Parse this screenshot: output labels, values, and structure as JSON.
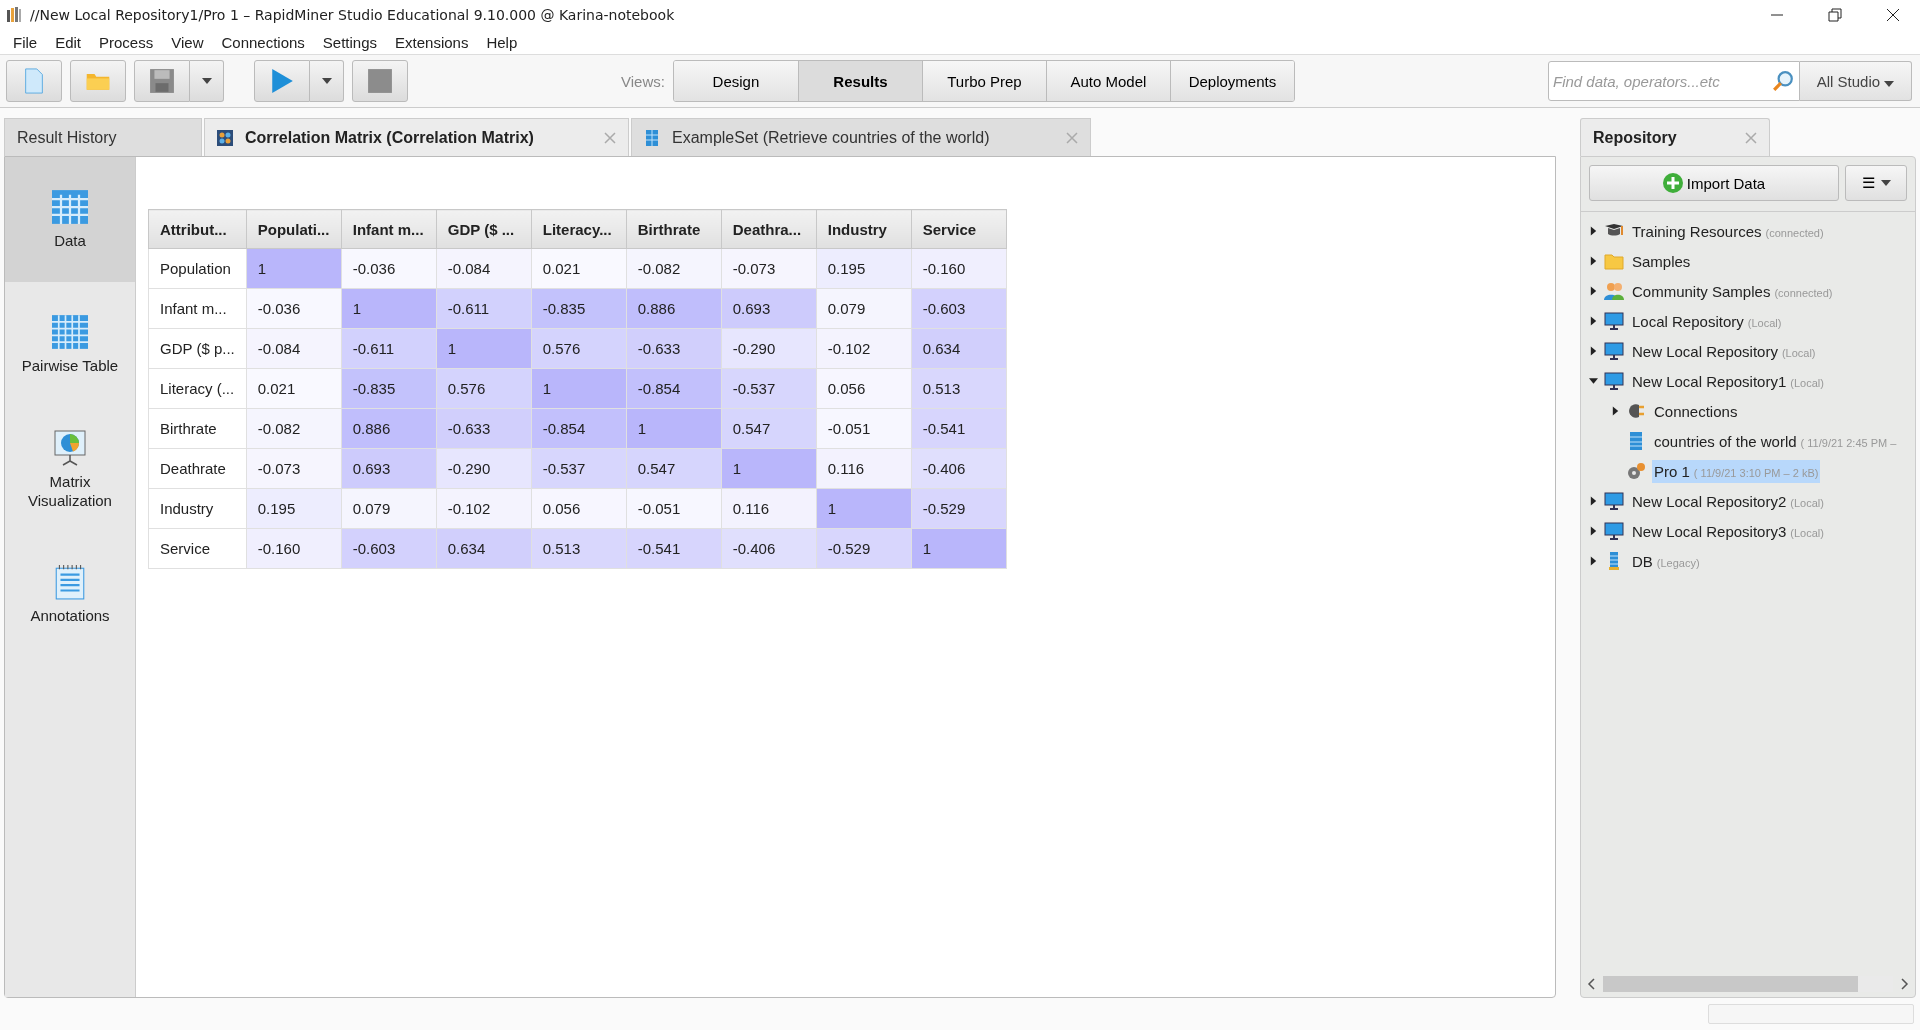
{
  "window": {
    "title": "//New Local Repository1/Pro 1 – RapidMiner Studio Educational 9.10.000 @ Karina-notebook"
  },
  "menu": [
    "File",
    "Edit",
    "Process",
    "View",
    "Connections",
    "Settings",
    "Extensions",
    "Help"
  ],
  "views": {
    "label": "Views:",
    "items": [
      {
        "label": "Design",
        "selected": false
      },
      {
        "label": "Results",
        "selected": true
      },
      {
        "label": "Turbo Prep",
        "selected": false
      },
      {
        "label": "Auto Model",
        "selected": false
      },
      {
        "label": "Deployments",
        "selected": false
      }
    ]
  },
  "search": {
    "placeholder": "Find data, operators...etc",
    "scope": "All Studio"
  },
  "result_tabs": [
    {
      "label": "Result History",
      "kind": "history",
      "selected": false
    },
    {
      "label": "Correlation Matrix (Correlation Matrix)",
      "kind": "matrix",
      "selected": true
    },
    {
      "label": "ExampleSet (Retrieve countries of the world)",
      "kind": "table",
      "selected": false
    }
  ],
  "side_views": [
    {
      "label": "Data",
      "kind": "data",
      "selected": true
    },
    {
      "label": "Pairwise Table",
      "kind": "pairwise",
      "selected": false
    },
    {
      "label": "Matrix Visualization",
      "kind": "viz",
      "selected": false
    },
    {
      "label": "Annotations",
      "kind": "notes",
      "selected": false
    }
  ],
  "table": {
    "columns": [
      "Attribut...",
      "Populati...",
      "Infant m...",
      "GDP ($ ...",
      "Literacy...",
      "Birthrate",
      "Deathra...",
      "Industry",
      "Service"
    ],
    "rows": [
      [
        "Population",
        "1",
        "-0.036",
        "-0.084",
        "0.021",
        "-0.082",
        "-0.073",
        "0.195",
        "-0.160"
      ],
      [
        "Infant m...",
        "-0.036",
        "1",
        "-0.611",
        "-0.835",
        "0.886",
        "0.693",
        "0.079",
        "-0.603"
      ],
      [
        "GDP ($ p...",
        "-0.084",
        "-0.611",
        "1",
        "0.576",
        "-0.633",
        "-0.290",
        "-0.102",
        "0.634"
      ],
      [
        "Literacy (...",
        "0.021",
        "-0.835",
        "0.576",
        "1",
        "-0.854",
        "-0.537",
        "0.056",
        "0.513"
      ],
      [
        "Birthrate",
        "-0.082",
        "0.886",
        "-0.633",
        "-0.854",
        "1",
        "0.547",
        "-0.051",
        "-0.541"
      ],
      [
        "Deathrate",
        "-0.073",
        "0.693",
        "-0.290",
        "-0.537",
        "0.547",
        "1",
        "0.116",
        "-0.406"
      ],
      [
        "Industry",
        "0.195",
        "0.079",
        "-0.102",
        "0.056",
        "-0.051",
        "0.116",
        "1",
        "-0.529"
      ],
      [
        "Service",
        "-0.160",
        "-0.603",
        "0.634",
        "0.513",
        "-0.541",
        "-0.406",
        "-0.529",
        "1"
      ]
    ]
  },
  "repository": {
    "title": "Repository",
    "import_button": "Import Data",
    "menu_button": "☰",
    "tree": [
      {
        "name": "Training Resources",
        "note": "(connected)",
        "kind": "training",
        "expanded": false,
        "selected": false
      },
      {
        "name": "Samples",
        "kind": "folder",
        "expanded": false,
        "selected": false
      },
      {
        "name": "Community Samples",
        "note": "(connected)",
        "kind": "community",
        "expanded": false,
        "selected": false
      },
      {
        "name": "Local Repository",
        "note": "(Local)",
        "kind": "repo",
        "expanded": false,
        "selected": false
      },
      {
        "name": "New Local Repository",
        "note": "(Local)",
        "kind": "repo",
        "expanded": false,
        "selected": false
      },
      {
        "name": "New Local Repository1",
        "note": "(Local)",
        "kind": "repo",
        "expanded": true,
        "selected": false,
        "children": [
          {
            "name": "Connections",
            "kind": "connections",
            "expanded": false,
            "selected": false
          },
          {
            "name": "countries of the world",
            "note": "( 11/9/21 2:45 PM –",
            "kind": "data",
            "selected": false
          },
          {
            "name": "Pro 1",
            "note": "( 11/9/21 3:10 PM – 2 kB)",
            "kind": "process",
            "selected": true
          }
        ]
      },
      {
        "name": "New Local Repository2",
        "note": "(Local)",
        "kind": "repo",
        "expanded": false,
        "selected": false
      },
      {
        "name": "New Local Repository3",
        "note": "(Local)",
        "kind": "repo",
        "expanded": false,
        "selected": false
      },
      {
        "name": "DB",
        "note": "(Legacy)",
        "kind": "db",
        "expanded": false,
        "selected": false
      }
    ]
  }
}
